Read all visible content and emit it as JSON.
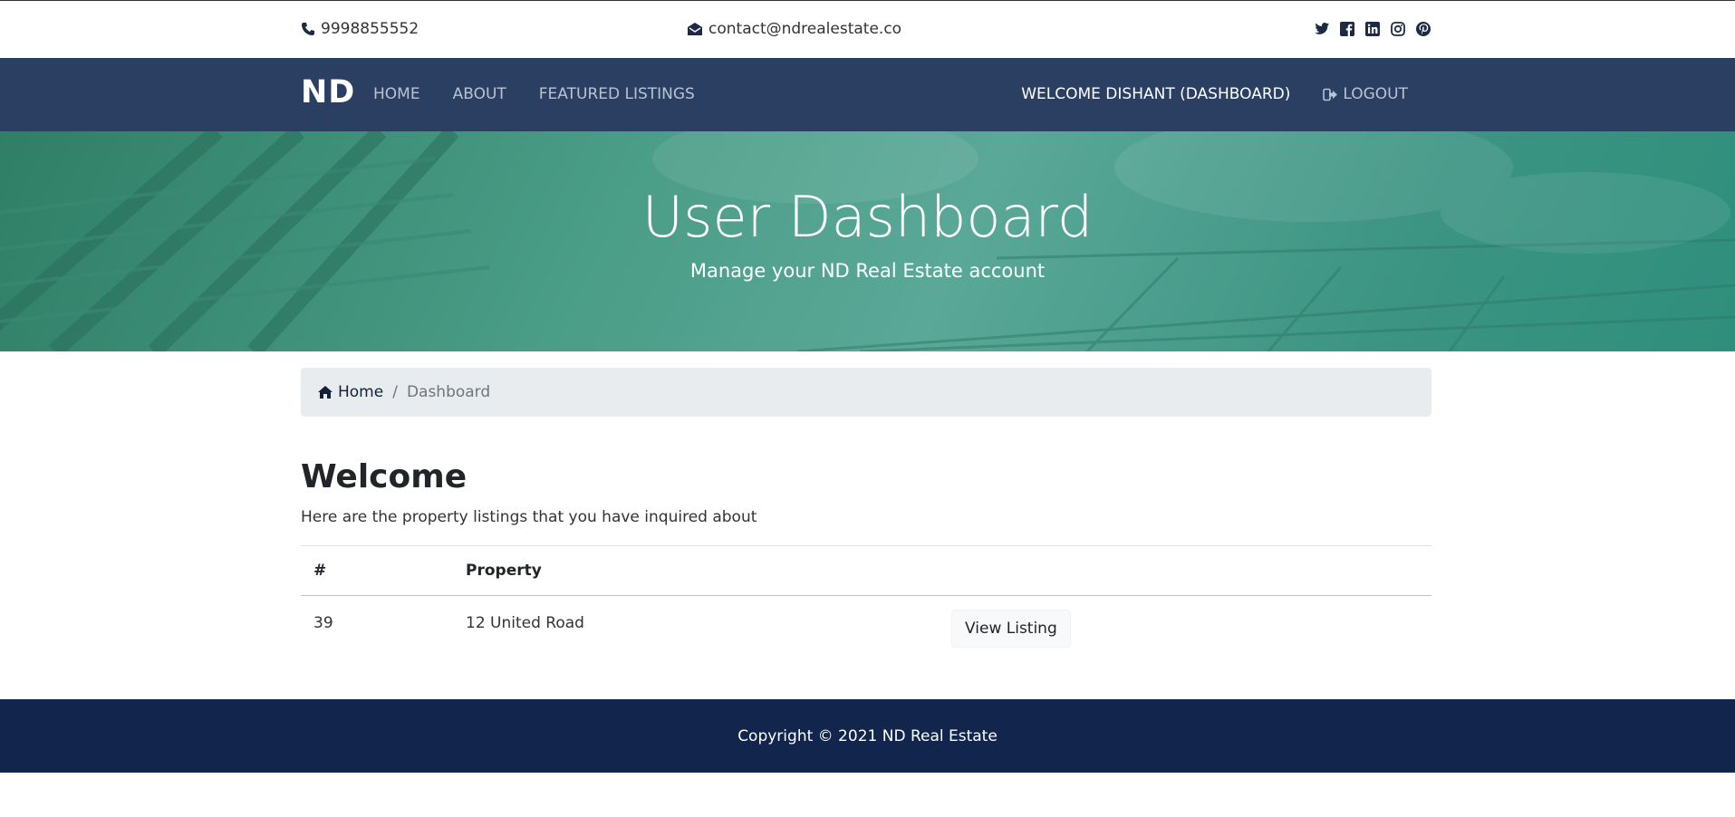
{
  "topbar": {
    "phone": "9998855552",
    "email": "contact@ndrealestate.co",
    "social": [
      "twitter-icon",
      "facebook-icon",
      "linkedin-icon",
      "instagram-icon",
      "pinterest-icon"
    ]
  },
  "navbar": {
    "brand": "ND",
    "links": [
      "HOME",
      "ABOUT",
      "FEATURED LISTINGS"
    ],
    "welcome": "WELCOME DISHANT (DASHBOARD)",
    "logout": "LOGOUT"
  },
  "hero": {
    "title": "User Dashboard",
    "subtitle": "Manage your ND Real Estate account"
  },
  "breadcrumb": {
    "home": "Home",
    "separator": "/",
    "current": "Dashboard"
  },
  "main": {
    "heading": "Welcome",
    "intro": "Here are the property listings that you have inquired about",
    "table": {
      "headers": [
        "#",
        "Property",
        ""
      ],
      "rows": [
        {
          "id": "39",
          "property": "12 United Road",
          "action": "View Listing"
        }
      ]
    }
  },
  "footer": {
    "copyright": "Copyright © 2021 ND Real Estate"
  },
  "colors": {
    "navbar": "#2a3f62",
    "hero": "#4a9d86",
    "footer": "#12264d"
  }
}
